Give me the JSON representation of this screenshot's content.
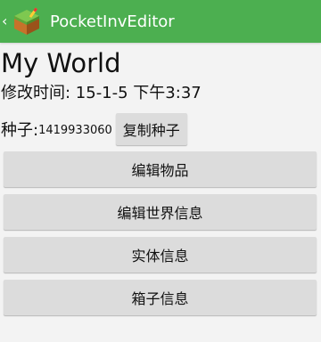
{
  "action_bar": {
    "title": "PocketInvEditor",
    "up_glyph": "‹",
    "color": "#4caf50",
    "app_icon": "minecraft-chest-block-icon"
  },
  "world": {
    "name": "My World",
    "modified": "修改时间: 15-1-5 下午3:37",
    "seed_label": "种子:",
    "seed_value": "1419933060",
    "copy_seed_label": "复制种子"
  },
  "menu": [
    {
      "label": "编辑物品"
    },
    {
      "label": "编辑世界信息"
    },
    {
      "label": "实体信息"
    },
    {
      "label": "箱子信息"
    }
  ]
}
